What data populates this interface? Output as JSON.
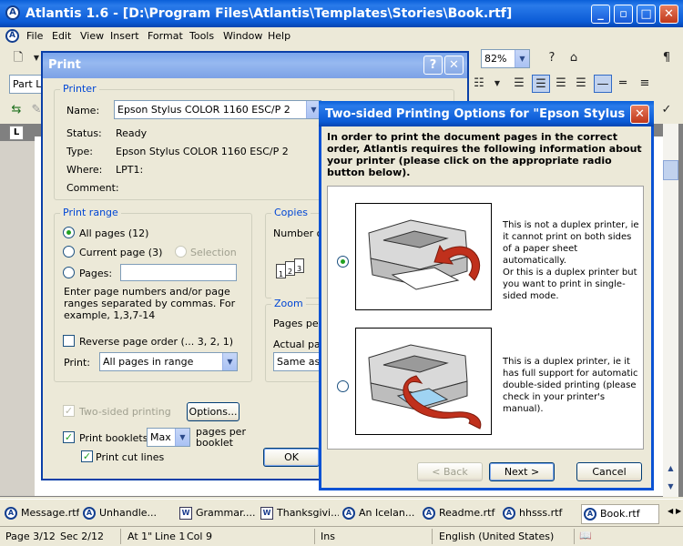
{
  "window": {
    "title": "Atlantis 1.6 - [D:\\Program Files\\Atlantis\\Templates\\Stories\\Book.rtf]"
  },
  "menu": [
    "File",
    "Edit",
    "View",
    "Insert",
    "Format",
    "Tools",
    "Window",
    "Help"
  ],
  "toolbar": {
    "zoom": "82%",
    "style_combo": "Part La"
  },
  "ruler": {
    "tab_marker": "L"
  },
  "print_dialog": {
    "title": "Print",
    "printer_group": "Printer",
    "name_label": "Name:",
    "name_value": "Epson Stylus COLOR 1160 ESC/P 2",
    "status_label": "Status:",
    "status_value": "Ready",
    "type_label": "Type:",
    "type_value": "Epson Stylus COLOR 1160 ESC/P 2",
    "where_label": "Where:",
    "where_value": "LPT1:",
    "comment_label": "Comment:",
    "print_range_group": "Print range",
    "all_pages": "All pages (12)",
    "current_page": "Current page (3)",
    "selection": "Selection",
    "pages": "Pages:",
    "pages_hint": "Enter page numbers and/or page ranges separated by commas. For example, 1,3,7-14",
    "reverse_order": "Reverse page order (... 3, 2, 1)",
    "print_label": "Print:",
    "print_value": "All pages in range",
    "copies_group": "Copies",
    "number_of": "Number of",
    "zoom_group": "Zoom",
    "pages_per": "Pages per",
    "actual_pap": "Actual pap",
    "same_as": "Same as d",
    "two_sided": "Two-sided printing",
    "options_button": "Options...",
    "print_booklets": "Print booklets:",
    "booklet_value": "Max",
    "pages_per_booklet": "pages per booklet",
    "print_cut_lines": "Print cut lines",
    "ok_button": "OK"
  },
  "twosided_dialog": {
    "title": "Two-sided Printing Options for \"Epson Stylus COLO...",
    "intro": "In order to print the document pages in the correct order, Atlantis requires the following information about your printer (please click on the appropriate radio button below).",
    "option1": "This is not a duplex printer, ie it cannot print on both sides of a paper sheet automatically.\nOr this is a duplex printer but you want to print in single-sided mode.",
    "option2": "This is a duplex printer, ie it has full support for automatic double-sided printing (please check in your printer's manual).",
    "back_button": "< Back",
    "next_button": "Next >",
    "cancel_button": "Cancel"
  },
  "taskbar": [
    "Message.rtf",
    "Unhandle...",
    "Grammar....",
    "Thanksgivi...",
    "An Icelan...",
    "Readme.rtf",
    "hhsss.rtf",
    "Book.rtf"
  ],
  "status": {
    "page": "Page 3/12",
    "sec": "Sec 2/12",
    "at": "At 1\"",
    "line": "Line 1",
    "col": "Col 9",
    "ins": "Ins",
    "lang": "English (United States)"
  },
  "colors": {
    "title_blue": "#0a5fd9",
    "group_label": "#0046d5",
    "arrow_red": "#c0301c"
  }
}
